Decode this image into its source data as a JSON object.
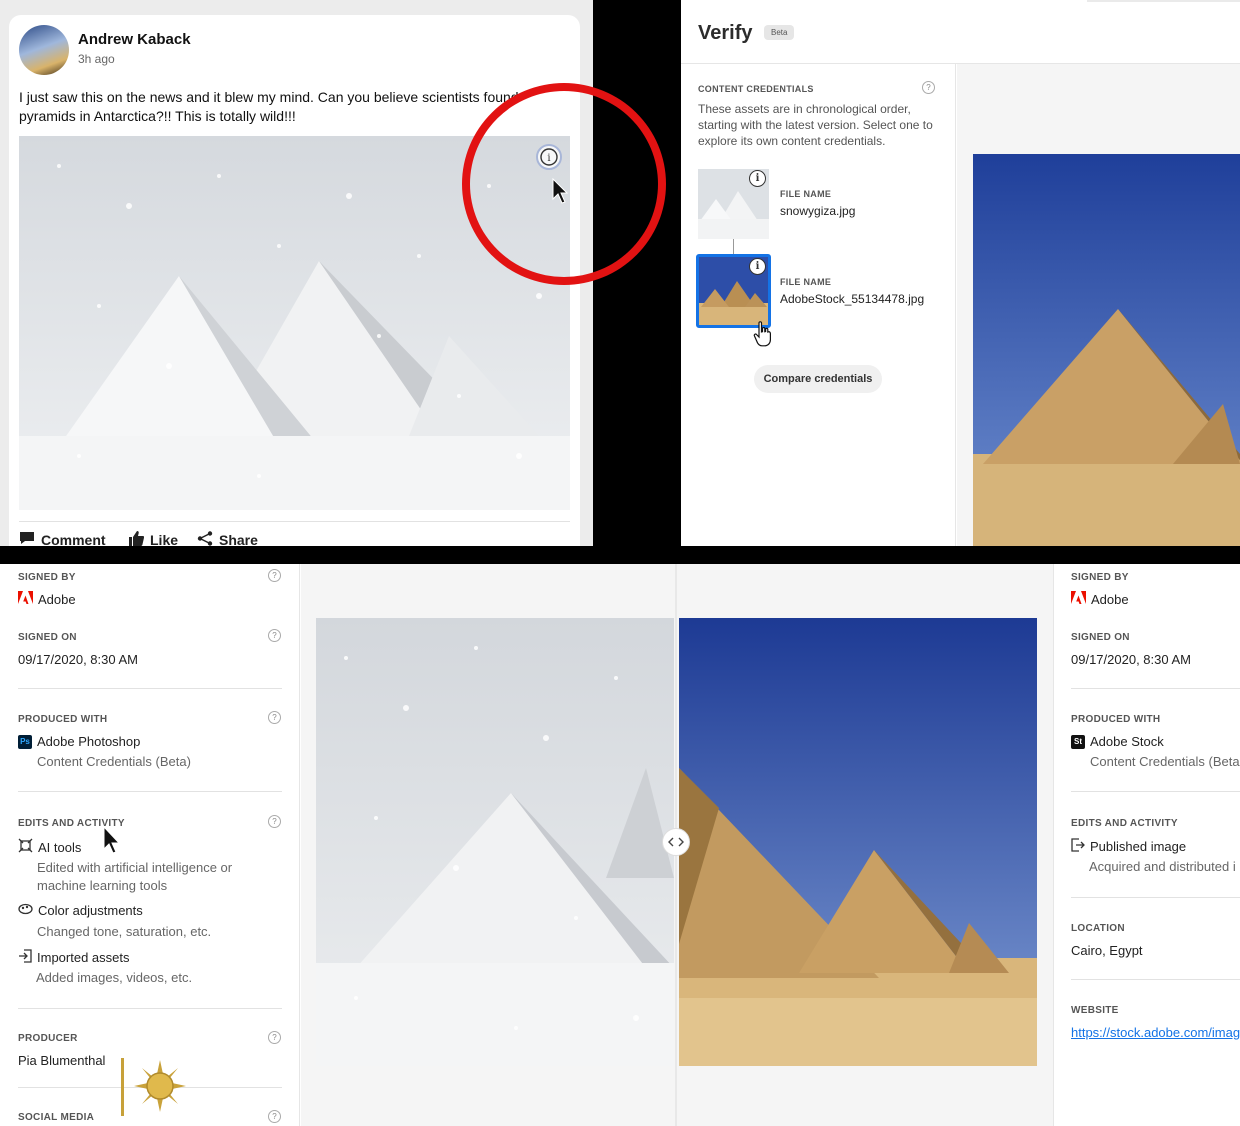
{
  "post": {
    "author": "Andrew Kaback",
    "time": "3h ago",
    "text": "I just saw this on the news and it blew my mind. Can you believe scientists found pyramids in Antarctica?!! This is totally wild!!!",
    "actions": {
      "comment": "Comment",
      "like": "Like",
      "share": "Share"
    },
    "info_icon": "i"
  },
  "verify": {
    "title": "Verify",
    "badge": "Beta",
    "content_credentials": {
      "heading": "CONTENT CREDENTIALS",
      "description": "These assets are in chronological order, starting with the latest version. Select one to explore its own content credentials."
    },
    "assets": [
      {
        "caption": "FILE NAME",
        "name": "snowygiza.jpg"
      },
      {
        "caption": "FILE NAME",
        "name": "AdobeStock_55134478.jpg"
      }
    ],
    "compare_button": "Compare credentials",
    "help_glyph": "?"
  },
  "left_credentials": {
    "signed_by": {
      "label": "SIGNED BY",
      "value": "Adobe"
    },
    "signed_on": {
      "label": "SIGNED ON",
      "value": "09/17/2020, 8:30 AM"
    },
    "produced_with": {
      "label": "PRODUCED WITH",
      "badge": "Ps",
      "app": "Adobe Photoshop",
      "detail": "Content Credentials (Beta)"
    },
    "edits": {
      "label": "EDITS AND ACTIVITY",
      "items": [
        {
          "title": "AI tools",
          "desc": "Edited with artificial intelligence or machine learning tools",
          "icon": "ai-tools-icon"
        },
        {
          "title": "Color adjustments",
          "desc": "Changed tone, saturation, etc.",
          "icon": "color-adjustments-icon"
        },
        {
          "title": "Imported assets",
          "desc": "Added images, videos, etc.",
          "icon": "imported-assets-icon"
        }
      ]
    },
    "producer": {
      "label": "PRODUCER",
      "value": "Pia Blumenthal"
    },
    "social_media": {
      "label": "SOCIAL MEDIA"
    }
  },
  "right_credentials": {
    "signed_by": {
      "label": "SIGNED BY",
      "value": "Adobe"
    },
    "signed_on": {
      "label": "SIGNED ON",
      "value": "09/17/2020, 8:30 AM"
    },
    "produced_with": {
      "label": "PRODUCED WITH",
      "badge": "St",
      "app": "Adobe Stock",
      "detail": "Content Credentials (Beta"
    },
    "edits": {
      "label": "EDITS AND ACTIVITY",
      "title": "Published image",
      "desc": "Acquired and distributed i"
    },
    "location": {
      "label": "LOCATION",
      "value": "Cairo, Egypt"
    },
    "website": {
      "label": "WEBSITE",
      "value": "https://stock.adobe.com/imag"
    }
  },
  "colors": {
    "accent": "#1473e6",
    "highlight": "#e21212",
    "adobe_red": "#eb1000"
  }
}
